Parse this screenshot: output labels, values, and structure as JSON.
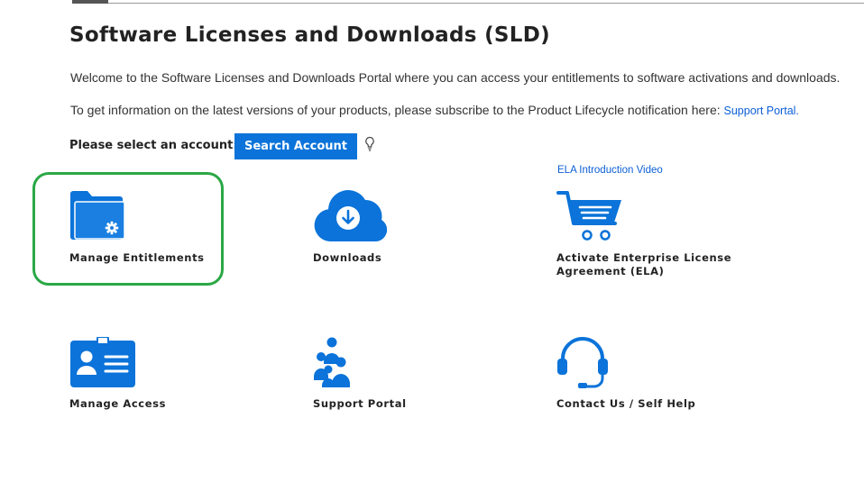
{
  "page": {
    "title": "Software Licenses and Downloads (SLD)",
    "welcome": "Welcome to the Software Licenses and Downloads Portal where you can access your entitlements to software activations and downloads.",
    "info_prefix": "To get information on the latest versions of your products, please subscribe to the Product Lifecycle notification here:",
    "info_link": "Support Portal."
  },
  "account": {
    "label": "Please select an account:",
    "button": "Search Account",
    "hint_icon": "lightbulb-icon"
  },
  "ela_video_link": "ELA Introduction Video",
  "tiles": [
    {
      "label": "Manage Entitlements",
      "icon": "folder-gear-icon"
    },
    {
      "label": "Downloads",
      "icon": "cloud-download-icon"
    },
    {
      "label": "Activate Enterprise License Agreement (ELA)",
      "icon": "shopping-cart-icon"
    },
    {
      "label": "Manage Access",
      "icon": "id-badge-icon"
    },
    {
      "label": "Support Portal",
      "icon": "people-group-icon"
    },
    {
      "label": "Contact Us / Self Help",
      "icon": "headset-icon"
    }
  ],
  "colors": {
    "accent": "#0b73d9",
    "highlight": "#2aa845",
    "text": "#222222"
  }
}
